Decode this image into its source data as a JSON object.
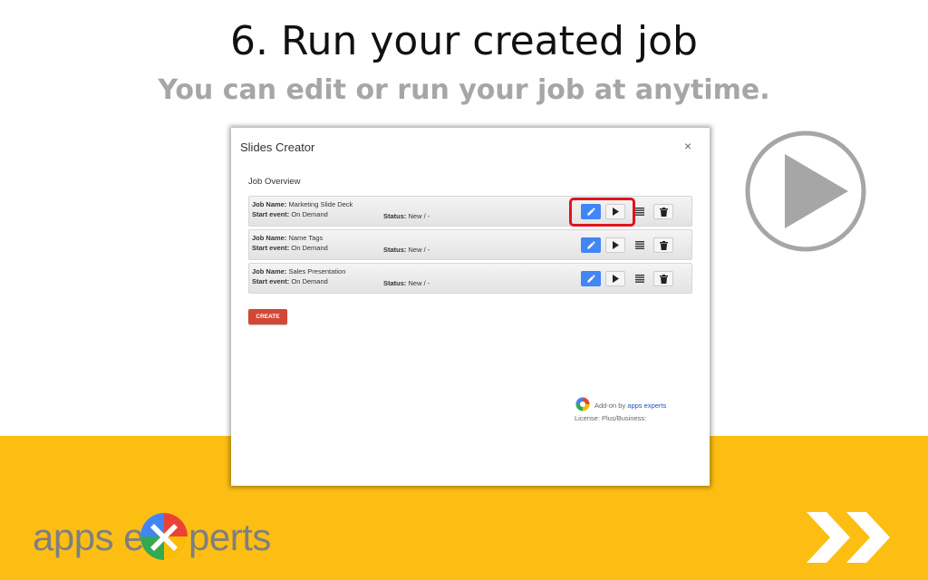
{
  "slide": {
    "title": "6. Run your created job",
    "subtitle": "You can edit or run your job at anytime."
  },
  "dialog": {
    "title": "Slides Creator",
    "close_glyph": "×",
    "section_title": "Job Overview",
    "job_name_label": "Job Name:",
    "start_event_label": "Start event:",
    "status_label": "Status:",
    "jobs": [
      {
        "name": "Marketing Slide Deck",
        "start_event": "On Demand",
        "status": "New / -"
      },
      {
        "name": "Name Tags",
        "start_event": "On Demand",
        "status": "New / -"
      },
      {
        "name": "Sales Presentation",
        "start_event": "On Demand",
        "status": "New / -"
      }
    ],
    "create_label": "CREATE",
    "addon_prefix": "Add-on by",
    "addon_link": "apps experts",
    "license": "License: Plus/Business:"
  },
  "brand": {
    "left": "apps e",
    "right": "perts"
  },
  "colors": {
    "accent_yellow": "#FDBE14",
    "edit_blue": "#4285F4",
    "create_red": "#D14836",
    "highlight_red": "#E0141E",
    "subtitle_gray": "#A6A6A6"
  },
  "icons": [
    "play-circle-icon",
    "close-icon",
    "edit-pencil-icon",
    "play-icon",
    "list-icon",
    "trash-icon",
    "apps-experts-logo-icon",
    "double-chevron-right-icon"
  ]
}
